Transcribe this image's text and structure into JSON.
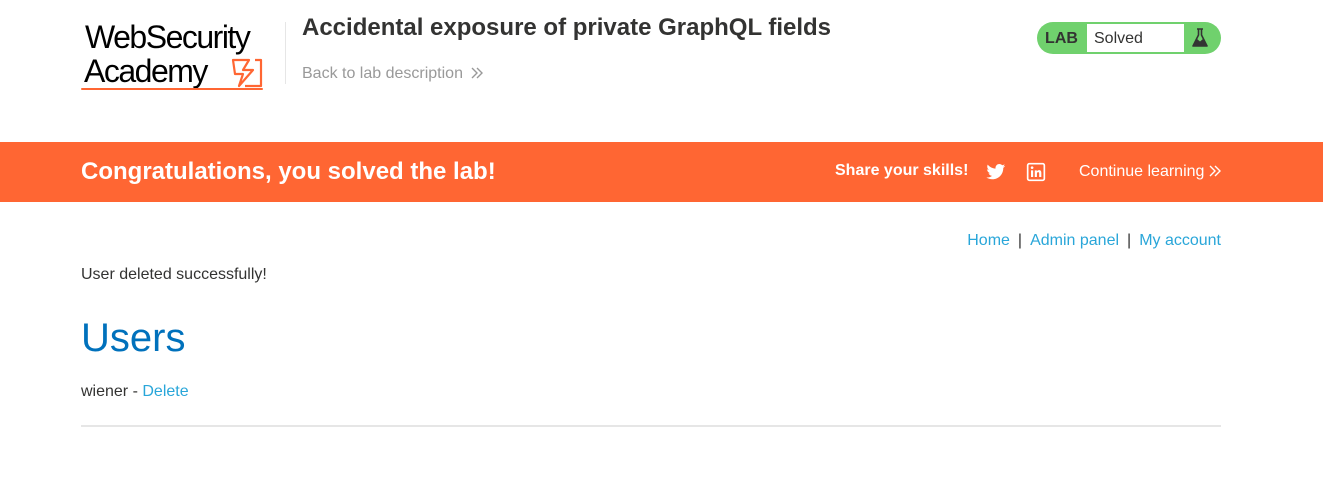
{
  "brand": {
    "line1": "WebSecurity",
    "line2": "Academy",
    "accent_color": "#ff6633"
  },
  "lab": {
    "title": "Accidental exposure of private GraphQL fields",
    "back_link": "Back to lab description",
    "status_tag": "LAB",
    "status_value": "Solved",
    "status_color": "#70d16d",
    "status_icon": "flask-icon"
  },
  "banner": {
    "message": "Congratulations, you solved the lab!",
    "share_label": "Share your skills!",
    "social_icons": [
      "twitter-icon",
      "linkedin-icon"
    ],
    "continue_label": "Continue learning",
    "background_color": "#ff6633"
  },
  "nav": {
    "home": "Home",
    "separator": "|",
    "admin_panel": "Admin panel",
    "my_account": "My account"
  },
  "main": {
    "message": "User deleted successfully!",
    "heading": "Users",
    "users": [
      {
        "name": "wiener",
        "separator": " - ",
        "action": "Delete"
      }
    ]
  }
}
